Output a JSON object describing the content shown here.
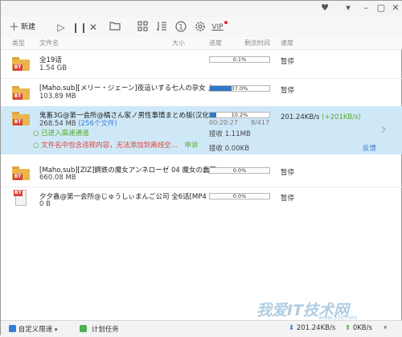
{
  "toolbar": {
    "new_label": "新建",
    "vip_label": "VIP"
  },
  "columns": {
    "type": "类型",
    "filename": "文件名",
    "size": "大小",
    "progress": "进度",
    "remaining": "剩余时间",
    "speed": "速度"
  },
  "tasks": [
    {
      "name": "全19话",
      "size": "1.54 GB",
      "progress_text": "0.1%",
      "progress": 0.001,
      "status": "暂停",
      "icon": "folder-bt-icon"
    },
    {
      "name": "[Maho.sub][メリー・ジェーン]夜這いする七人の孕女 上...",
      "size": "103.89 MB",
      "progress_text": "37.0%",
      "progress": 0.37,
      "status": "暂停",
      "icon": "folder-bt-icon"
    },
    {
      "name": "鬼畜3G@第一会所@橘さん家ノ男性事情まとめ版(汉化)",
      "size": "268.54 MB",
      "file_count": "(256个文件)",
      "progress_text": "10.2%",
      "progress": 0.102,
      "elapsed": "00:20:27",
      "peers": "8/417",
      "speed": "201.24KB/s",
      "speed_boost": "(+201KB/s)",
      "high_speed_note": "已进入高速通道",
      "warning": "文件名中包含违规内容，无法添加到离线空...",
      "appeal": "申诉",
      "recv1": "接收 1.11MB",
      "recv2": "接收 0.00KB",
      "feedback": "反馈",
      "icon": "folder-bt-icon"
    },
    {
      "name": "[Maho.sub][ZIZ]鋼鉄の魔女アンネローゼ 04 魔女の蠢落...",
      "size": "660.08 MB",
      "progress_text": "0.0%",
      "progress": 0.0,
      "status": "暂停",
      "icon": "folder-bt-icon"
    },
    {
      "name": "夕夕鑫@第一会所@じゅうしぃまんご公司 全6话[MP4 ...",
      "size": "0 B",
      "progress_text": "0.0%",
      "progress": 0.0,
      "status": "暂停",
      "icon": "bt-file-icon"
    }
  ],
  "bottombar": {
    "speed_limit": "自定义限速",
    "schedule": "计划任务",
    "down_speed": "201.24KB/s",
    "up_speed": "0KB/s"
  },
  "watermark": {
    "main": "我爱IT技术网",
    "sub": "www.52ij.com"
  }
}
